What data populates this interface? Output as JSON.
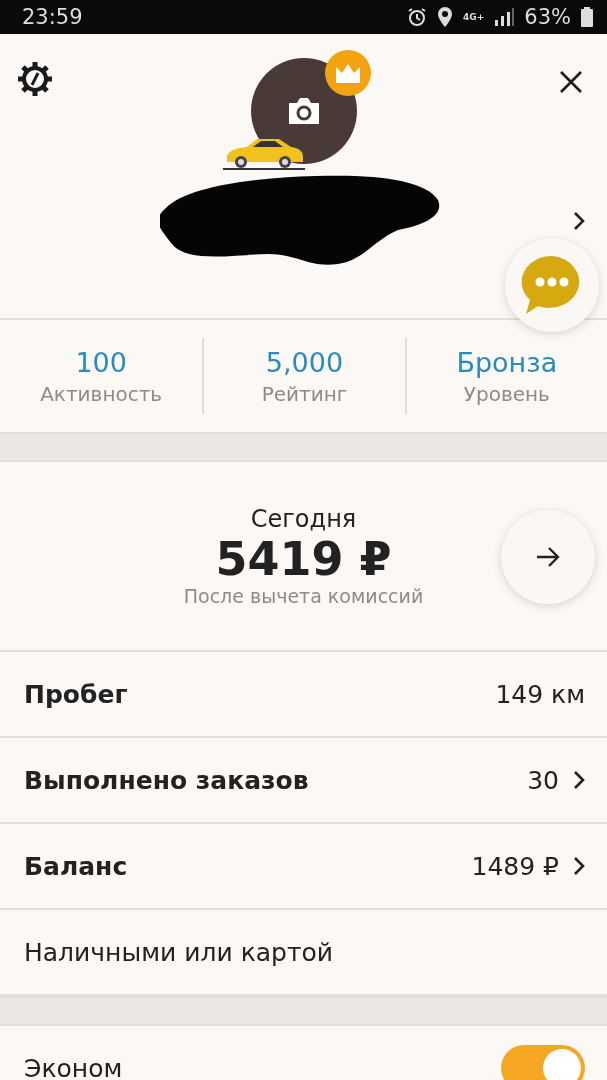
{
  "status_bar": {
    "time": "23:59",
    "network": "4G+",
    "battery": "63%"
  },
  "profile": {
    "has_crown": true
  },
  "stats": [
    {
      "value": "100",
      "label": "Активность"
    },
    {
      "value": "5,000",
      "label": "Рейтинг"
    },
    {
      "value": "Бронза",
      "label": "Уровень"
    }
  ],
  "today": {
    "title": "Сегодня",
    "amount": "5419 ₽",
    "note": "После вычета комиссий"
  },
  "rows": [
    {
      "label": "Пробег",
      "value": "149 км",
      "chevron": false
    },
    {
      "label": "Выполнено заказов",
      "value": "30",
      "chevron": true
    },
    {
      "label": "Баланс",
      "value": "1489 ₽",
      "chevron": true
    },
    {
      "label": "Наличными или картой",
      "chevron": false
    }
  ],
  "tariffs": [
    {
      "label": "Эконом",
      "on": true
    }
  ]
}
